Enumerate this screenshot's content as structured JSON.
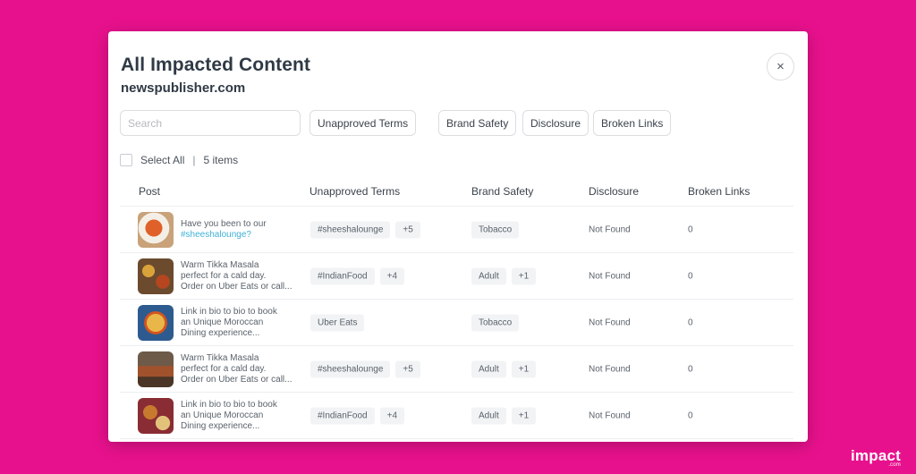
{
  "modal": {
    "title": "All Impacted Content",
    "subtitle": "newspublisher.com",
    "close_label": "×"
  },
  "search": {
    "placeholder": "Search",
    "value": ""
  },
  "filters": [
    "Unapproved Terms",
    "Brand Safety",
    "Disclosure",
    "Broken Links"
  ],
  "selection": {
    "select_all_label": "Select All",
    "separator": "|",
    "count_label": "5 items"
  },
  "table": {
    "columns": [
      "Post",
      "Unapproved Terms",
      "Brand Safety",
      "Disclosure",
      "Broken Links"
    ],
    "rows": [
      {
        "post_lines": [
          "Have you been to our"
        ],
        "post_hashtag": "#sheeshalounge?",
        "thumb": "curry-bowl",
        "unapproved_terms": [
          "#sheeshalounge",
          "+5"
        ],
        "brand_safety": [
          "Tobacco"
        ],
        "disclosure": "Not Found",
        "broken_links": "0"
      },
      {
        "post_lines": [
          "Warm Tikka Masala",
          "perfect for a cald day.",
          "Order on Uber Eats or call..."
        ],
        "post_hashtag": "",
        "thumb": "indian-spread",
        "unapproved_terms": [
          "#IndianFood",
          "+4"
        ],
        "brand_safety": [
          "Adult",
          "+1"
        ],
        "disclosure": "Not Found",
        "broken_links": "0"
      },
      {
        "post_lines": [
          "Link in bio to bio to book",
          "an Unique Moroccan",
          "Dining experience..."
        ],
        "post_hashtag": "",
        "thumb": "couscous",
        "unapproved_terms": [
          "Uber Eats"
        ],
        "brand_safety": [
          "Tobacco"
        ],
        "disclosure": "Not Found",
        "broken_links": "0"
      },
      {
        "post_lines": [
          "Warm Tikka Masala",
          "perfect for a cald day.",
          "Order on Uber Eats or call..."
        ],
        "post_hashtag": "",
        "thumb": "restaurant-interior",
        "unapproved_terms": [
          "#sheeshalounge",
          "+5"
        ],
        "brand_safety": [
          "Adult",
          "+1"
        ],
        "disclosure": "Not Found",
        "broken_links": "0"
      },
      {
        "post_lines": [
          "Link in bio to bio to book",
          "an Unique Moroccan",
          "Dining experience..."
        ],
        "post_hashtag": "",
        "thumb": "moroccan-dishes",
        "unapproved_terms": [
          "#IndianFood",
          "+4"
        ],
        "brand_safety": [
          "Adult",
          "+1"
        ],
        "disclosure": "Not Found",
        "broken_links": "0"
      }
    ]
  },
  "brand": {
    "logo_text": "impact",
    "logo_suffix": ".com"
  },
  "colors": {
    "background": "#e8118d",
    "hashtag": "#3fb1d6",
    "text_dark": "#2f3a45",
    "chip_bg": "#f1f3f5"
  }
}
